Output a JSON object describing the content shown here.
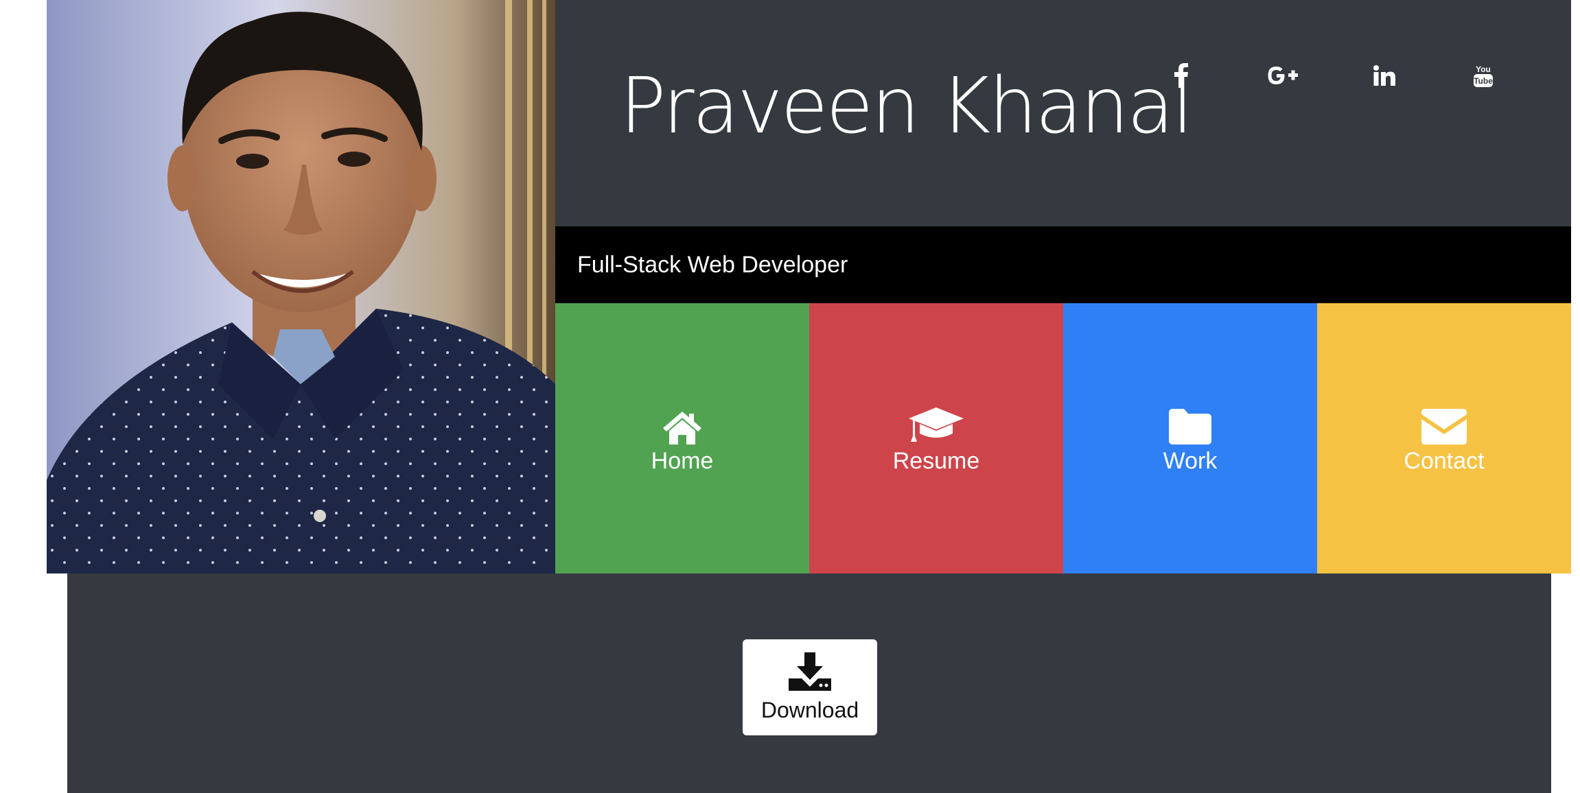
{
  "profile": {
    "name": "Praveen Khanal",
    "subtitle": "Full-Stack Web Developer"
  },
  "socials": [
    {
      "icon": "facebook-icon"
    },
    {
      "icon": "google-plus-icon"
    },
    {
      "icon": "linkedin-icon"
    },
    {
      "icon": "youtube-icon"
    }
  ],
  "nav": {
    "tiles": [
      {
        "label": "Home",
        "icon": "home-icon",
        "color": "#51a351"
      },
      {
        "label": "Resume",
        "icon": "graduation-cap-icon",
        "color": "#cd444a"
      },
      {
        "label": "Work",
        "icon": "folder-icon",
        "color": "#2f80f5"
      },
      {
        "label": "Contact",
        "icon": "envelope-icon",
        "color": "#f6c244"
      }
    ]
  },
  "download": {
    "label": "Download",
    "icon": "download-icon"
  },
  "theme": {
    "dark": "#343a40",
    "black": "#000000",
    "white": "#ffffff"
  }
}
